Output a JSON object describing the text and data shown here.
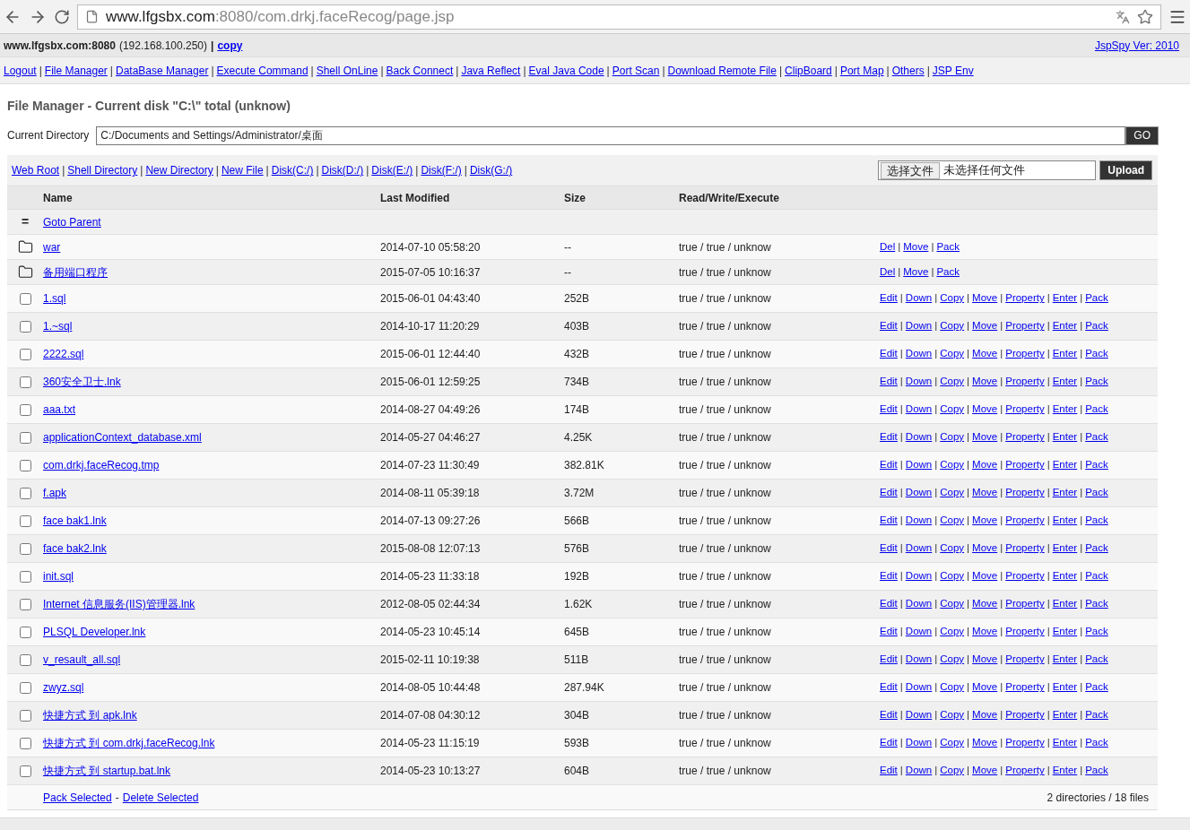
{
  "browser": {
    "url_host": "www.lfgsbx.com",
    "url_path": ":8080/com.drkj.faceRecog/page.jsp"
  },
  "header": {
    "host": "www.lfgsbx.com:8080",
    "ip": "(192.168.100.250)",
    "separator": "|",
    "copy": "copy",
    "version": "JspSpy Ver: 2010"
  },
  "nav": {
    "separator": "|",
    "links": [
      "Logout",
      "File Manager",
      "DataBase Manager",
      "Execute Command",
      "Shell OnLine",
      "Back Connect",
      "Java Reflect",
      "Eval Java Code",
      "Port Scan",
      "Download Remote File",
      "ClipBoard",
      "Port Map",
      "Others",
      "JSP Env"
    ]
  },
  "title": "File Manager - Current disk \"C:\\\" total (unknow)",
  "current_directory": {
    "label": "Current Directory",
    "value": "C:/Documents and Settings/Administrator/桌面",
    "go": "GO"
  },
  "dir_links": {
    "separator": "|",
    "links": [
      "Web Root",
      "Shell Directory",
      "New Directory",
      "New File",
      "Disk(C:/)",
      "Disk(D:/)",
      "Disk(E:/)",
      "Disk(F:/)",
      "Disk(G:/)"
    ]
  },
  "upload": {
    "choose": "选择文件",
    "status": "未选择任何文件",
    "button": "Upload"
  },
  "table": {
    "columns": [
      "Name",
      "Last Modified",
      "Size",
      "Read/Write/Execute"
    ],
    "parent": {
      "mark": "=",
      "label": "Goto Parent"
    },
    "separator": "|",
    "rows": [
      {
        "kind": "folder",
        "name": "war",
        "modified": "2014-07-10 05:58:20",
        "size": "--",
        "rwx": "true / true / unknow",
        "actions": [
          "Del",
          "Move",
          "Pack"
        ]
      },
      {
        "kind": "folder",
        "name": "备用端口程序",
        "modified": "2015-07-05 10:16:37",
        "size": "--",
        "rwx": "true / true / unknow",
        "actions": [
          "Del",
          "Move",
          "Pack"
        ]
      },
      {
        "kind": "file",
        "checked": false,
        "name": "1.sql",
        "modified": "2015-06-01 04:43:40",
        "size": "252B",
        "rwx": "true / true / unknow",
        "actions": [
          "Edit",
          "Down",
          "Copy",
          "Move",
          "Property",
          "Enter",
          "Pack"
        ]
      },
      {
        "kind": "file",
        "checked": false,
        "name": "1.~sql",
        "modified": "2014-10-17 11:20:29",
        "size": "403B",
        "rwx": "true / true / unknow",
        "actions": [
          "Edit",
          "Down",
          "Copy",
          "Move",
          "Property",
          "Enter",
          "Pack"
        ]
      },
      {
        "kind": "file",
        "checked": false,
        "name": "2222.sql",
        "modified": "2015-06-01 12:44:40",
        "size": "432B",
        "rwx": "true / true / unknow",
        "actions": [
          "Edit",
          "Down",
          "Copy",
          "Move",
          "Property",
          "Enter",
          "Pack"
        ]
      },
      {
        "kind": "file",
        "checked": false,
        "name": "360安全卫士.lnk",
        "modified": "2015-06-01 12:59:25",
        "size": "734B",
        "rwx": "true / true / unknow",
        "actions": [
          "Edit",
          "Down",
          "Copy",
          "Move",
          "Property",
          "Enter",
          "Pack"
        ]
      },
      {
        "kind": "file",
        "checked": false,
        "name": "aaa.txt",
        "modified": "2014-08-27 04:49:26",
        "size": "174B",
        "rwx": "true / true / unknow",
        "actions": [
          "Edit",
          "Down",
          "Copy",
          "Move",
          "Property",
          "Enter",
          "Pack"
        ]
      },
      {
        "kind": "file",
        "checked": false,
        "name": "applicationContext_database.xml",
        "modified": "2014-05-27 04:46:27",
        "size": "4.25K",
        "rwx": "true / true / unknow",
        "actions": [
          "Edit",
          "Down",
          "Copy",
          "Move",
          "Property",
          "Enter",
          "Pack"
        ]
      },
      {
        "kind": "file",
        "checked": false,
        "name": "com.drkj.faceRecog.tmp",
        "modified": "2014-07-23 11:30:49",
        "size": "382.81K",
        "rwx": "true / true / unknow",
        "actions": [
          "Edit",
          "Down",
          "Copy",
          "Move",
          "Property",
          "Enter",
          "Pack"
        ]
      },
      {
        "kind": "file",
        "checked": false,
        "name": "f.apk",
        "modified": "2014-08-11 05:39:18",
        "size": "3.72M",
        "rwx": "true / true / unknow",
        "actions": [
          "Edit",
          "Down",
          "Copy",
          "Move",
          "Property",
          "Enter",
          "Pack"
        ]
      },
      {
        "kind": "file",
        "checked": false,
        "name": "face bak1.lnk",
        "modified": "2014-07-13 09:27:26",
        "size": "566B",
        "rwx": "true / true / unknow",
        "actions": [
          "Edit",
          "Down",
          "Copy",
          "Move",
          "Property",
          "Enter",
          "Pack"
        ]
      },
      {
        "kind": "file",
        "checked": false,
        "name": "face bak2.lnk",
        "modified": "2015-08-08 12:07:13",
        "size": "576B",
        "rwx": "true / true / unknow",
        "actions": [
          "Edit",
          "Down",
          "Copy",
          "Move",
          "Property",
          "Enter",
          "Pack"
        ]
      },
      {
        "kind": "file",
        "checked": false,
        "name": "init.sql",
        "modified": "2014-05-23 11:33:18",
        "size": "192B",
        "rwx": "true / true / unknow",
        "actions": [
          "Edit",
          "Down",
          "Copy",
          "Move",
          "Property",
          "Enter",
          "Pack"
        ]
      },
      {
        "kind": "file",
        "checked": false,
        "name": "Internet 信息服务(IIS)管理器.lnk",
        "modified": "2012-08-05 02:44:34",
        "size": "1.62K",
        "rwx": "true / true / unknow",
        "actions": [
          "Edit",
          "Down",
          "Copy",
          "Move",
          "Property",
          "Enter",
          "Pack"
        ]
      },
      {
        "kind": "file",
        "checked": false,
        "name": "PLSQL Developer.lnk",
        "modified": "2014-05-23 10:45:14",
        "size": "645B",
        "rwx": "true / true / unknow",
        "actions": [
          "Edit",
          "Down",
          "Copy",
          "Move",
          "Property",
          "Enter",
          "Pack"
        ]
      },
      {
        "kind": "file",
        "checked": false,
        "name": "v_resault_all.sql",
        "modified": "2015-02-11 10:19:38",
        "size": "511B",
        "rwx": "true / true / unknow",
        "actions": [
          "Edit",
          "Down",
          "Copy",
          "Move",
          "Property",
          "Enter",
          "Pack"
        ]
      },
      {
        "kind": "file",
        "checked": false,
        "name": "zwyz.sql",
        "modified": "2014-08-05 10:44:48",
        "size": "287.94K",
        "rwx": "true / true / unknow",
        "actions": [
          "Edit",
          "Down",
          "Copy",
          "Move",
          "Property",
          "Enter",
          "Pack"
        ]
      },
      {
        "kind": "file",
        "checked": false,
        "name": "快捷方式 到 apk.lnk",
        "modified": "2014-07-08 04:30:12",
        "size": "304B",
        "rwx": "true / true / unknow",
        "actions": [
          "Edit",
          "Down",
          "Copy",
          "Move",
          "Property",
          "Enter",
          "Pack"
        ]
      },
      {
        "kind": "file",
        "checked": false,
        "name": "快捷方式 到 com.drkj.faceRecog.lnk",
        "modified": "2014-05-23 11:15:19",
        "size": "593B",
        "rwx": "true / true / unknow",
        "actions": [
          "Edit",
          "Down",
          "Copy",
          "Move",
          "Property",
          "Enter",
          "Pack"
        ]
      },
      {
        "kind": "file",
        "checked": false,
        "name": "快捷方式 到 startup.bat.lnk",
        "modified": "2014-05-23 10:13:27",
        "size": "604B",
        "rwx": "true / true / unknow",
        "actions": [
          "Edit",
          "Down",
          "Copy",
          "Move",
          "Property",
          "Enter",
          "Pack"
        ]
      }
    ],
    "footer": {
      "pack": "Pack Selected",
      "separator": "-",
      "delete": "Delete Selected",
      "summary": "2 directories / 18 files"
    }
  }
}
